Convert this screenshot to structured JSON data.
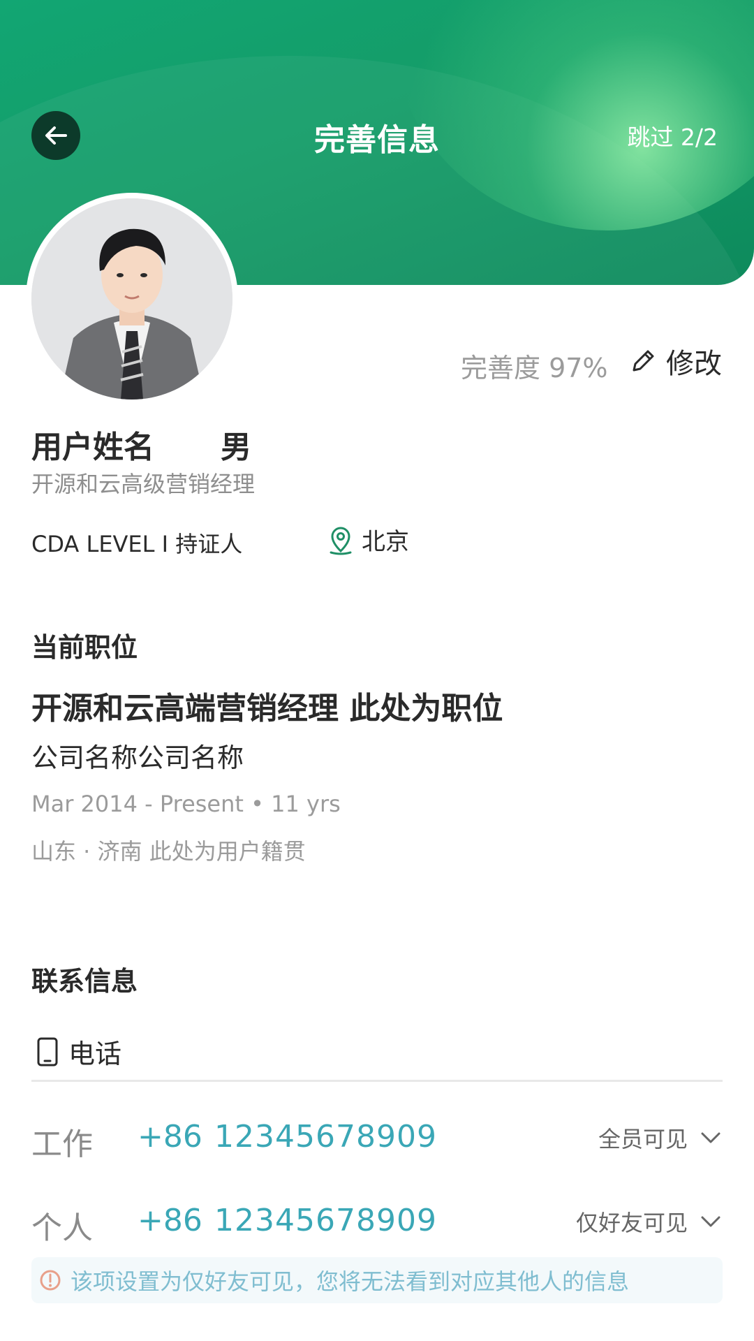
{
  "header": {
    "title": "完善信息",
    "skip_label": "跳过 2/2"
  },
  "profile": {
    "completion": "完善度 97%",
    "edit_label": "修改",
    "name": "用户姓名",
    "gender": "男",
    "subtitle": "开源和云高级营销经理",
    "certification": "CDA LEVEL I 持证人",
    "location": "北京"
  },
  "current_position": {
    "section_title": "当前职位",
    "title": "开源和云高端营销经理 此处为职位",
    "company": "公司名称公司名称",
    "dates": "Mar 2014 - Present • 11 yrs",
    "origin": "山东 · 济南 此处为用户籍贯"
  },
  "contact": {
    "section_title": "联系信息",
    "phone_label": "电话",
    "rows": [
      {
        "type": "工作",
        "country_code": "+86",
        "number": "12345678909",
        "visibility": "全员可见"
      },
      {
        "type": "个人",
        "country_code": "+86",
        "number": "12345678909",
        "visibility": "仅好友可见"
      }
    ],
    "notice": "该项设置为仅好友可见，您将无法看到对应其他人的信息"
  },
  "colors": {
    "header_green": "#12a673",
    "accent_teal": "#3aa7b6",
    "notice_text": "#7fbdd0",
    "warning_icon": "#e8a08a"
  }
}
